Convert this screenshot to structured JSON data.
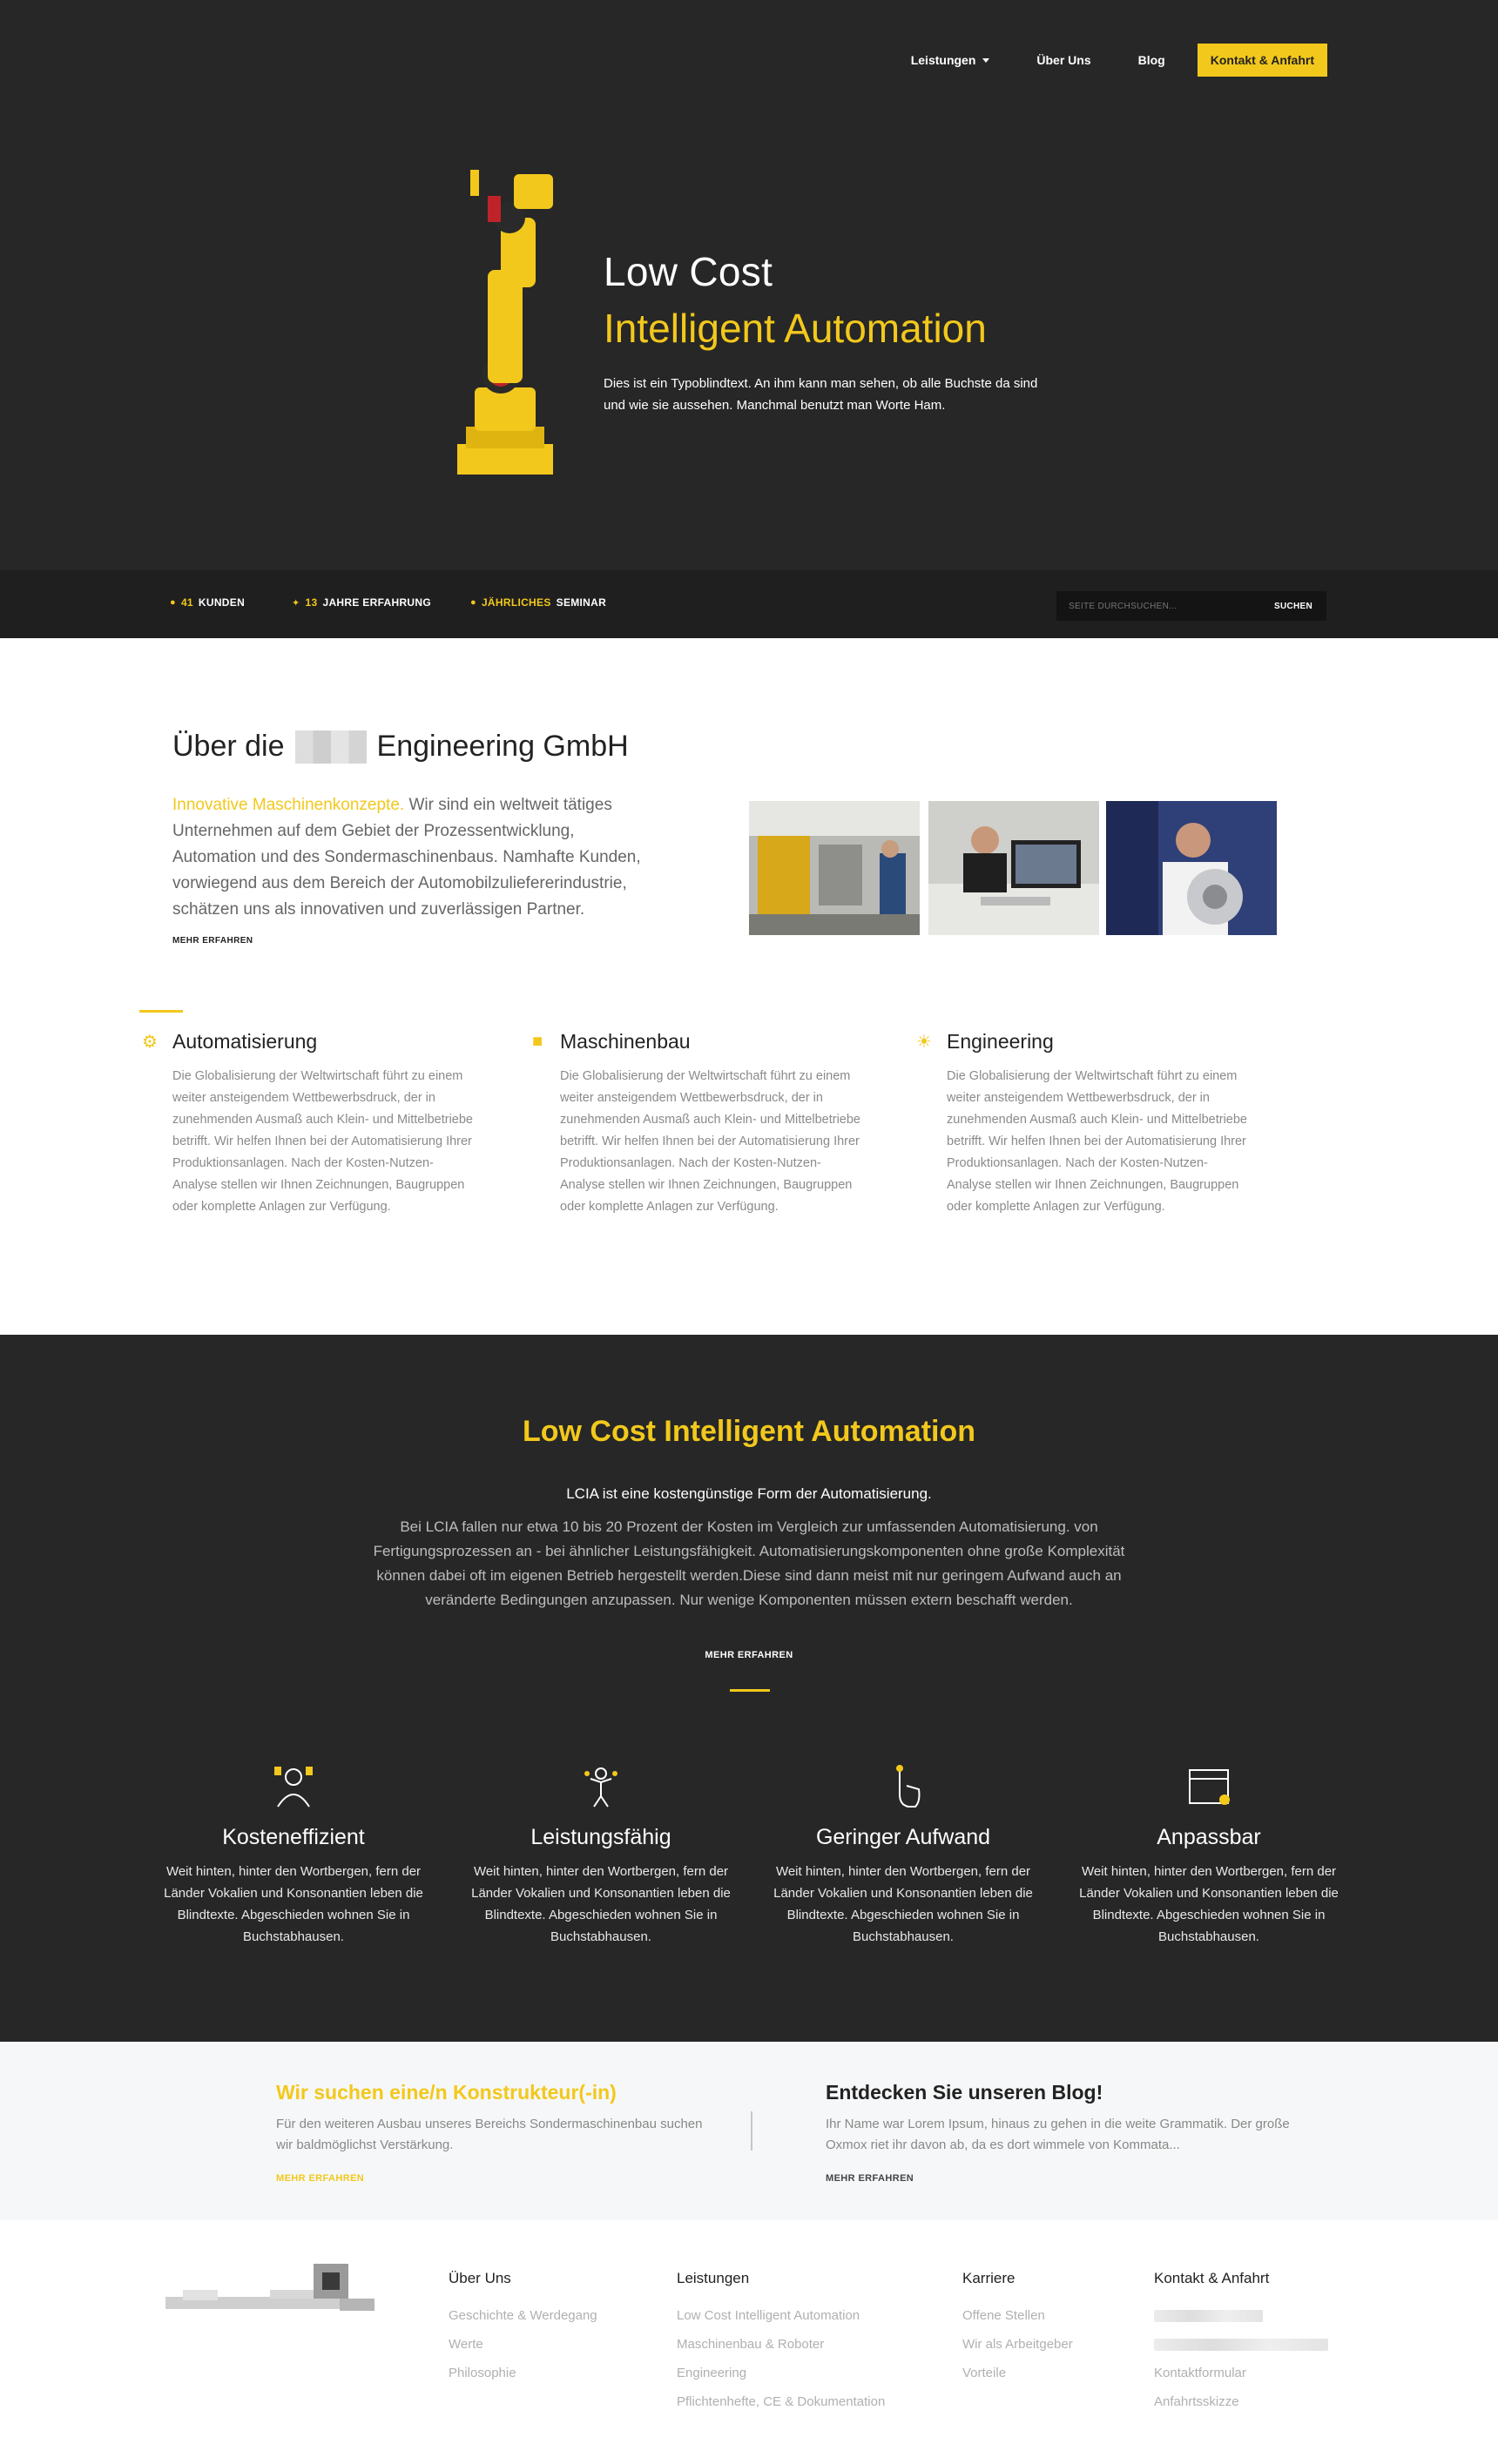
{
  "nav": {
    "items": [
      {
        "label": "Leistungen"
      },
      {
        "label": "Über Uns"
      },
      {
        "label": "Blog"
      }
    ],
    "cta_label": "Kontakt & Anfahrt"
  },
  "hero": {
    "title_line1": "Low Cost",
    "title_line2": "Intelligent Automation",
    "text": "Dies ist ein Typoblindtext. An ihm kann man sehen, ob alle Buchste da sind und wie sie aussehen. Manchmal benutzt man Worte Ham."
  },
  "stats": {
    "customers_num": "41",
    "customers_label": "KUNDEN",
    "years_num": "13",
    "years_label": "JAHRE ERFAHRUNG",
    "seminar_prefix": "JÄHRLICHES",
    "seminar_label": "SEMINAR",
    "search_placeholder": "SEITE DURCHSUCHEN...",
    "search_button": "SUCHEN"
  },
  "about": {
    "title_prefix": "Über die",
    "title_suffix": "Engineering GmbH",
    "highlight": "Innovative Maschinenkonzepte.",
    "text": " Wir sind ein weltweit tätiges Unternehmen auf dem Gebiet der Prozessentwicklung, Automation und des Sondermaschinenbaus. Namhafte Kunden, vorwiegend aus dem Bereich der Automobilzuliefererindustrie, schätzen uns als innovativen und zuverlässigen Partner.",
    "more": "MEHR ERFAHREN"
  },
  "features": [
    {
      "title": "Automatisierung",
      "icon": "robot-arm-icon",
      "text": "Die Globalisierung der Weltwirtschaft führt zu einem weiter ansteigendem Wettbewerbsdruck, der in zunehmenden Ausmaß auch Klein- und Mittelbetriebe betrifft. Wir helfen Ihnen bei der Automatisierung Ihrer Produktionsanlagen. Nach der Kosten-Nutzen-Analyse stellen wir Ihnen Zeichnungen, Baugruppen oder komplette Anlagen zur Verfügung."
    },
    {
      "title": "Maschinenbau",
      "icon": "truck-icon",
      "text": "Die Globalisierung der Weltwirtschaft führt zu einem weiter ansteigendem Wettbewerbsdruck, der in zunehmenden Ausmaß auch Klein- und Mittelbetriebe betrifft. Wir helfen Ihnen bei der Automatisierung Ihrer Produktionsanlagen. Nach der Kosten-Nutzen-Analyse stellen wir Ihnen Zeichnungen, Baugruppen oder komplette Anlagen zur Verfügung."
    },
    {
      "title": "Engineering",
      "icon": "lightbulb-icon",
      "text": "Die Globalisierung der Weltwirtschaft führt zu einem weiter ansteigendem Wettbewerbsdruck, der in zunehmenden Ausmaß auch Klein- und Mittelbetriebe betrifft. Wir helfen Ihnen bei der Automatisierung Ihrer Produktionsanlagen. Nach der Kosten-Nutzen-Analyse stellen wir Ihnen Zeichnungen, Baugruppen oder komplette Anlagen zur Verfügung."
    }
  ],
  "lcia": {
    "title": "Low Cost Intelligent Automation",
    "subtitle": "LCIA ist eine kostengünstige Form der Automatisierung.",
    "text": "Bei LCIA fallen nur etwa 10 bis 20 Prozent der Kosten im Vergleich zur umfassenden Automatisierung. von Fertigungsprozessen an - bei ähnlicher Leistungsfähigkeit. Automatisierungskomponenten ohne große Komplexität können dabei oft im eigenen Betrieb hergestellt werden.Diese sind dann meist mit nur geringem Aufwand auch an veränderte Bedingungen anzupassen. Nur wenige Komponenten müssen extern beschafft werden.",
    "more": "MEHR ERFAHREN",
    "columns": [
      {
        "title": "Kosteneffizient",
        "icon": "worker-icon",
        "text": "Weit hinten, hinter den Wortbergen, fern der Länder Vokalien und Konsonantien leben die Blindtexte. Abgeschieden wohnen Sie in Buchstabhausen."
      },
      {
        "title": "Leistungsfähig",
        "icon": "strong-figure-icon",
        "text": "Weit hinten, hinter den Wortbergen, fern der Länder Vokalien und Konsonantien leben die Blindtexte. Abgeschieden wohnen Sie in Buchstabhausen."
      },
      {
        "title": "Geringer Aufwand",
        "icon": "touch-hand-icon",
        "text": "Weit hinten, hinter den Wortbergen, fern der Länder Vokalien und Konsonantien leben die Blindtexte. Abgeschieden wohnen Sie in Buchstabhausen."
      },
      {
        "title": "Anpassbar",
        "icon": "calendar-icon",
        "text": "Weit hinten, hinter den Wortbergen, fern der Länder Vokalien und Konsonantien leben die Blindtexte. Abgeschieden wohnen Sie in Buchstabhausen."
      }
    ]
  },
  "job": {
    "title": "Wir suchen eine/n Konstrukteur(-in)",
    "text": "Für den weiteren Ausbau unseres Bereichs Sondermaschinenbau suchen wir baldmöglichst Verstärkung.",
    "more": "MEHR ERFAHREN"
  },
  "blog": {
    "title": "Entdecken Sie unseren Blog!",
    "text": "Ihr Name war Lorem Ipsum, hinaus zu gehen in die weite Grammatik. Der große Oxmox riet ihr davon ab, da es dort wimmele von Kommata...",
    "more": "MEHR ERFAHREN"
  },
  "footer": {
    "columns": [
      {
        "head": "Über Uns",
        "links": [
          "Geschichte & Werdegang",
          "Werte",
          "Philosophie"
        ]
      },
      {
        "head": "Leistungen",
        "links": [
          "Low Cost Intelligent Automation",
          "Maschinenbau & Roboter",
          "Engineering",
          "Pflichtenhefte, CE & Dokumentation"
        ]
      },
      {
        "head": "Karriere",
        "links": [
          "Offene Stellen",
          "Wir als Arbeitgeber",
          "Vorteile"
        ]
      },
      {
        "head": "Kontakt & Anfahrt",
        "links": [
          "Kontaktformular",
          "Anfahrtsskizze"
        ]
      }
    ]
  },
  "colors": {
    "accent": "#f2c81c",
    "dark": "#272727",
    "bar": "#1f1f1f"
  }
}
